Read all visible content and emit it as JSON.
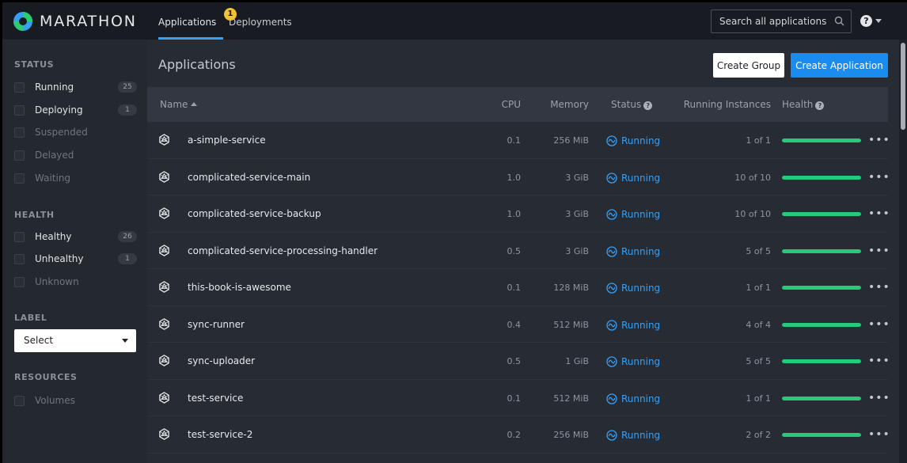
{
  "brand": {
    "name": "MARATHON",
    "colors": {
      "logo_blue": "#37a0f5",
      "logo_green": "#2ecc71"
    }
  },
  "nav": {
    "tabs": [
      {
        "label": "Applications",
        "active": true
      },
      {
        "label": "Deployments",
        "badge": "1"
      }
    ]
  },
  "search": {
    "placeholder": "Search all applications",
    "icon": "search-icon"
  },
  "help": {
    "icon": "help-icon",
    "glyph": "?"
  },
  "sidebar": {
    "status_heading": "STATUS",
    "status_items": [
      {
        "label": "Running",
        "count": "25"
      },
      {
        "label": "Deploying",
        "count": "1"
      },
      {
        "label": "Suspended"
      },
      {
        "label": "Delayed"
      },
      {
        "label": "Waiting"
      }
    ],
    "health_heading": "HEALTH",
    "health_items": [
      {
        "label": "Healthy",
        "count": "26"
      },
      {
        "label": "Unhealthy",
        "count": "1"
      },
      {
        "label": "Unknown"
      }
    ],
    "label_heading": "LABEL",
    "label_select": "Select",
    "resources_heading": "RESOURCES",
    "resources_items": [
      {
        "label": "Volumes"
      }
    ]
  },
  "main": {
    "title": "Applications",
    "create_group_label": "Create Group",
    "create_app_label": "Create Application",
    "columns": {
      "name": "Name",
      "cpu": "CPU",
      "memory": "Memory",
      "status": "Status",
      "instances": "Running Instances",
      "health": "Health"
    },
    "help_glyph": "?",
    "status_color": "#37a0f5",
    "health_color": "#27c97a",
    "apps": [
      {
        "name": "a-simple-service",
        "cpu": "0.1",
        "memory": "256 MiB",
        "status": "Running",
        "instances": "1 of 1",
        "health": 1.0
      },
      {
        "name": "complicated-service-main",
        "cpu": "1.0",
        "memory": "3 GiB",
        "status": "Running",
        "instances": "10 of 10",
        "health": 1.0
      },
      {
        "name": "complicated-service-backup",
        "cpu": "1.0",
        "memory": "3 GiB",
        "status": "Running",
        "instances": "10 of 10",
        "health": 1.0
      },
      {
        "name": "complicated-service-processing-handler",
        "cpu": "0.5",
        "memory": "3 GiB",
        "status": "Running",
        "instances": "5 of 5",
        "health": 1.0
      },
      {
        "name": "this-book-is-awesome",
        "cpu": "0.1",
        "memory": "128 MiB",
        "status": "Running",
        "instances": "1 of 1",
        "health": 1.0
      },
      {
        "name": "sync-runner",
        "cpu": "0.4",
        "memory": "512 MiB",
        "status": "Running",
        "instances": "4 of 4",
        "health": 1.0
      },
      {
        "name": "sync-uploader",
        "cpu": "0.5",
        "memory": "1 GiB",
        "status": "Running",
        "instances": "5 of 5",
        "health": 1.0
      },
      {
        "name": "test-service",
        "cpu": "0.1",
        "memory": "512 MiB",
        "status": "Running",
        "instances": "1 of 1",
        "health": 1.0
      },
      {
        "name": "test-service-2",
        "cpu": "0.2",
        "memory": "256 MiB",
        "status": "Running",
        "instances": "2 of 2",
        "health": 1.0
      }
    ],
    "more_glyph": "•••"
  }
}
